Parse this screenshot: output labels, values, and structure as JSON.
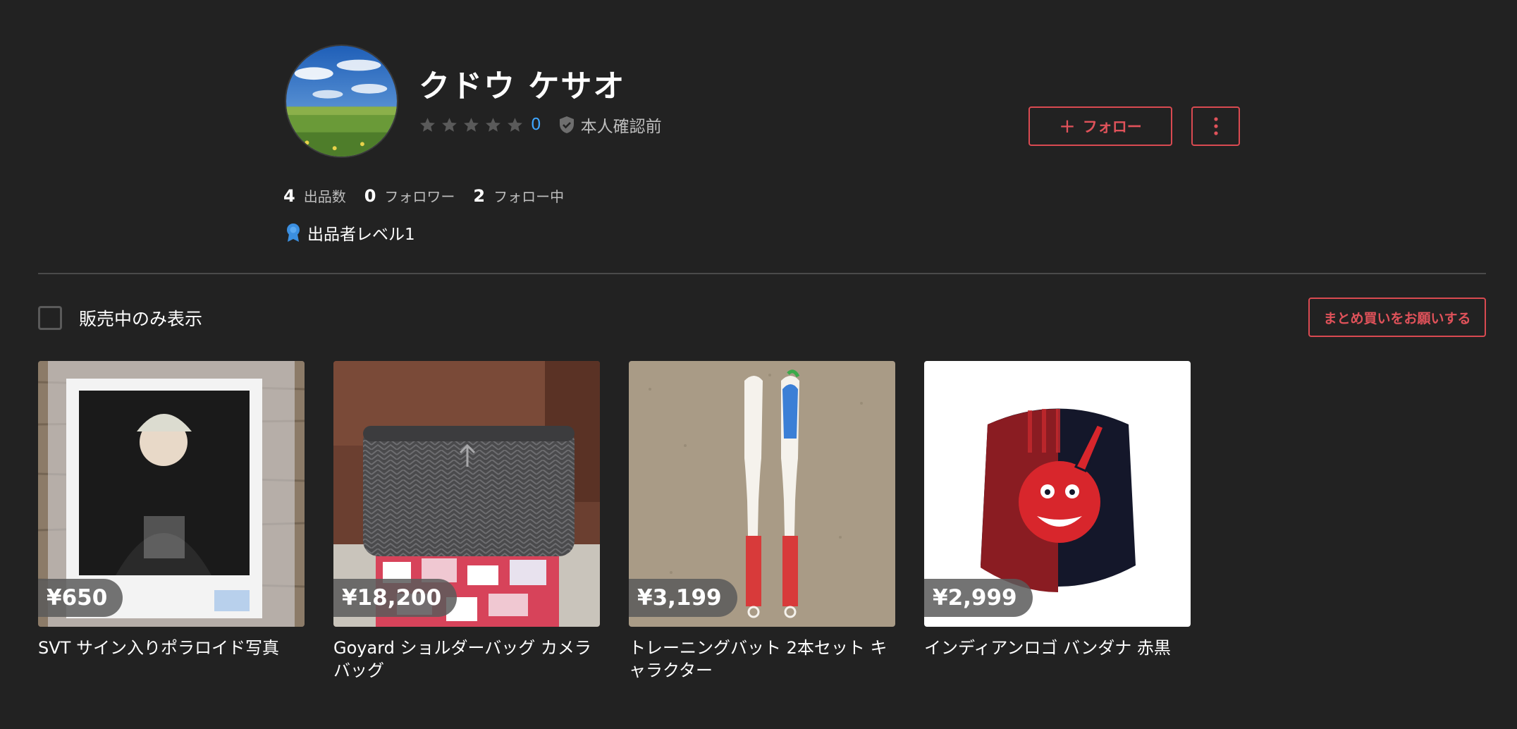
{
  "profile": {
    "name": "クドウ ケサオ",
    "rating_count": "0",
    "stars_filled": 0,
    "stars_total": 5,
    "verification": "本人確認前",
    "follow_label": "フォロー",
    "stats": [
      {
        "value": "4",
        "label": "出品数"
      },
      {
        "value": "0",
        "label": "フォロワー"
      },
      {
        "value": "2",
        "label": "フォロー中"
      }
    ],
    "level": "出品者レベル1"
  },
  "filter": {
    "on_sale_only_label": "販売中のみ表示",
    "on_sale_only_checked": false,
    "bulk_request_label": "まとめ買いをお願いする"
  },
  "items": [
    {
      "price": "¥650",
      "title": "SVT サイン入りポラロイド写真"
    },
    {
      "price": "¥18,200",
      "title": "Goyard ショルダーバッグ カメラバッグ"
    },
    {
      "price": "¥3,199",
      "title": "トレーニングバット 2本セット キャラクター"
    },
    {
      "price": "¥2,999",
      "title": "インディアンロゴ バンダナ 赤黒"
    }
  ],
  "colors": {
    "background": "#222222",
    "accent": "#e0525a",
    "rating_link": "#3fa6ff",
    "level_badge": "#3b8fe0"
  }
}
